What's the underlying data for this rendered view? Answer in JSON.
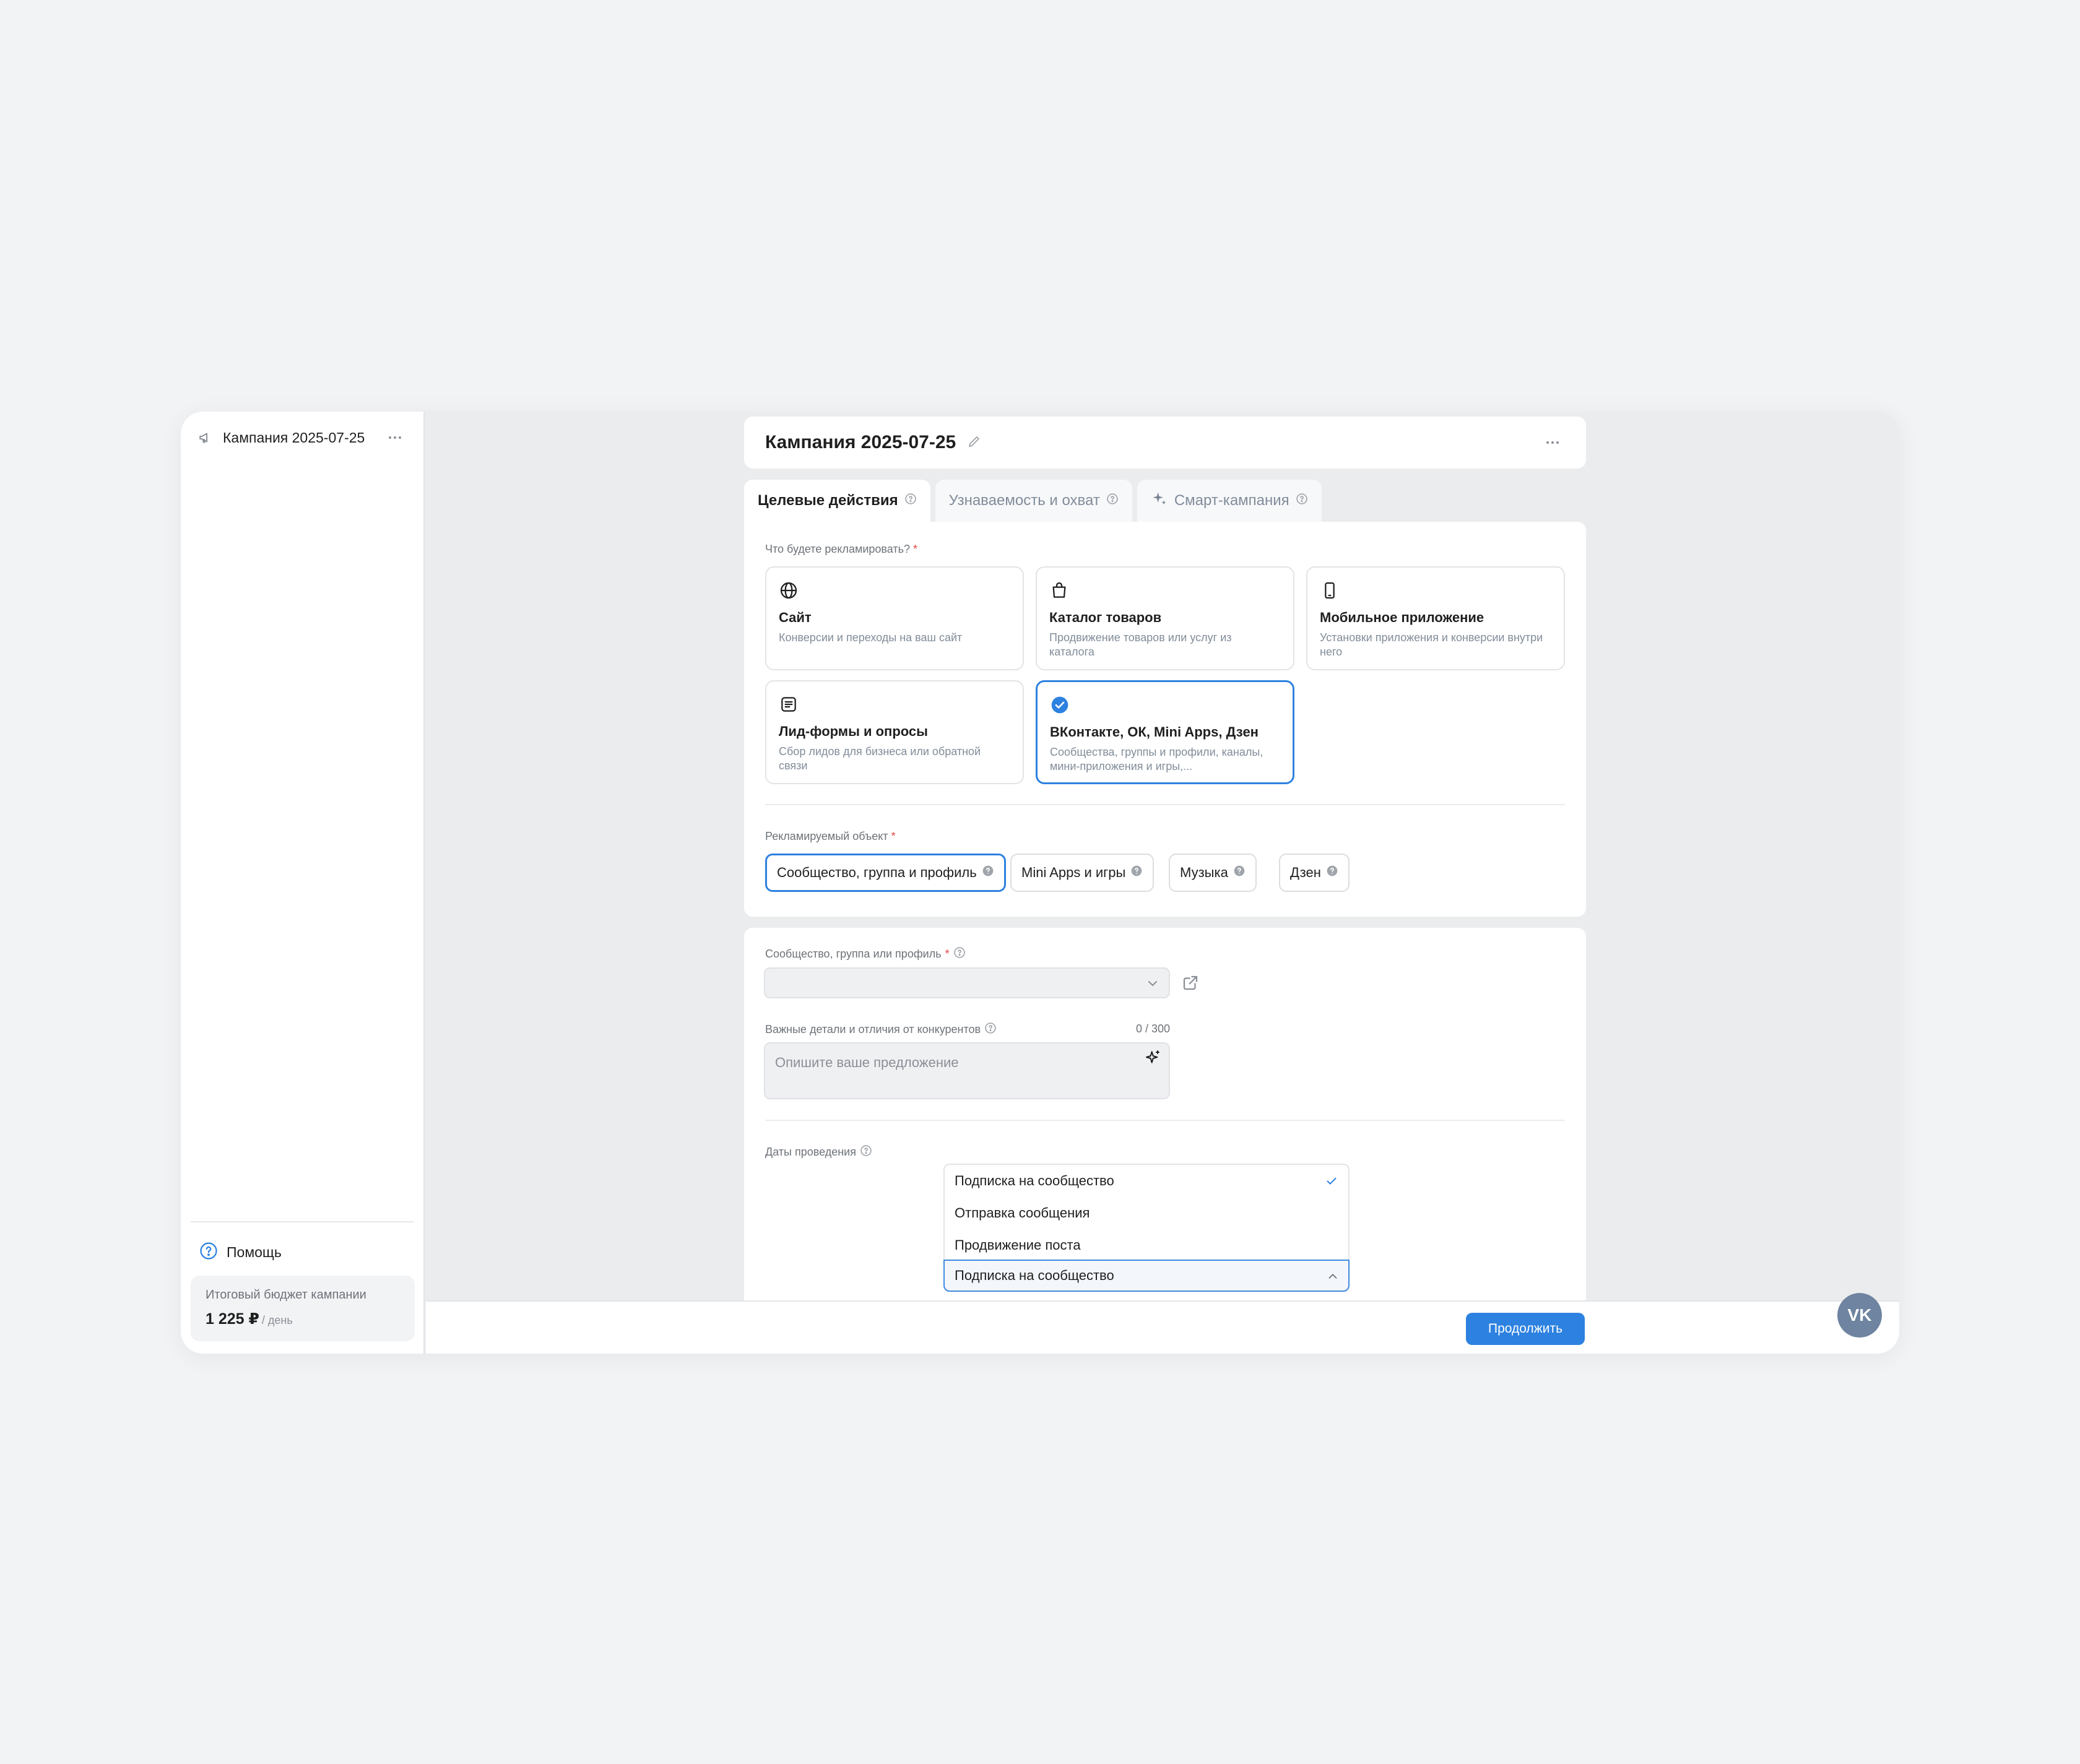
{
  "sidebar": {
    "campaign_title": "Кампания 2025-07-25",
    "help_label": "Помощь",
    "budget_caption": "Итоговый бюджет кампании",
    "budget_value": "1 225 ₽",
    "budget_unit": "/ день"
  },
  "header": {
    "title": "Кампания 2025-07-25"
  },
  "tabs": [
    {
      "label": "Целевые действия"
    },
    {
      "label": "Узнаваемость и охват"
    },
    {
      "label": "Смарт-кампания"
    }
  ],
  "what_to_advertise": {
    "label": "Что будете рекламировать?",
    "required_mark": "*",
    "options": [
      {
        "icon": "globe-icon",
        "title": "Сайт",
        "desc": "Конверсии и переходы на ваш сайт"
      },
      {
        "icon": "shopping-bag-icon",
        "title": "Каталог товаров",
        "desc": "Продвижение товаров или услуг из каталога"
      },
      {
        "icon": "phone-icon",
        "title": "Мобильное приложение",
        "desc": "Установки приложения и конверсии внутри него"
      },
      {
        "icon": "form-icon",
        "title": "Лид-формы и опросы",
        "desc": "Сбор лидов для бизнеса или обратной связи"
      },
      {
        "icon": "check-circle-icon",
        "title": "ВКонтакте, ОК, Mini Apps, Дзен",
        "desc": "Сообщества, группы и профили, каналы, мини-приложения и игры,..."
      }
    ],
    "selected_index": 4
  },
  "advertised_object": {
    "label": "Рекламируемый объект",
    "required_mark": "*",
    "chips": [
      {
        "label": "Сообщество, группа и профиль"
      },
      {
        "label": "Mini Apps и игры"
      },
      {
        "label": "Музыка"
      },
      {
        "label": "Дзен"
      }
    ],
    "selected_index": 0
  },
  "community_field": {
    "label": "Сообщество, группа или профиль",
    "required_mark": "*",
    "value": ""
  },
  "details_field": {
    "label": "Важные детали и отличия от конкурентов",
    "counter": "0 / 300",
    "placeholder": "Опишите ваше предложение"
  },
  "dates": {
    "label": "Даты проведения"
  },
  "goal_dropdown": {
    "options": [
      "Подписка на сообщество",
      "Отправка сообщения",
      "Продвижение поста"
    ],
    "selected": "Подписка на сообщество"
  },
  "footer": {
    "continue_label": "Продолжить"
  },
  "badge": {
    "text": "VK"
  },
  "colors": {
    "accent": "#2d81e0",
    "required": "#e64646",
    "badge": "#6e84a0"
  }
}
